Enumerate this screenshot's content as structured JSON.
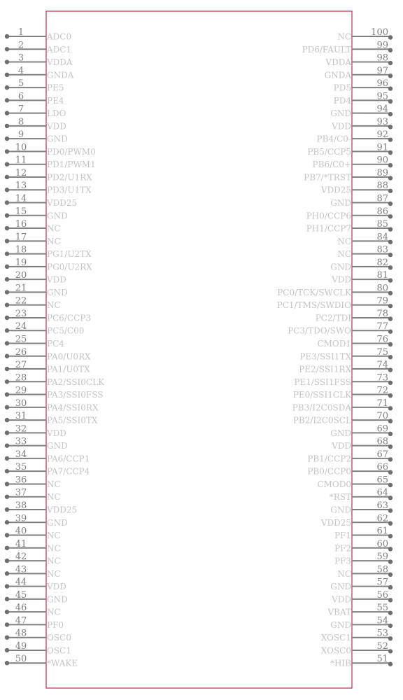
{
  "component": {
    "border_color": "#c8385a",
    "pin_color": "#808080",
    "label_color": "#c4c4c4"
  },
  "left_pins": [
    {
      "num": "1",
      "name": "ADC0"
    },
    {
      "num": "2",
      "name": "ADC1"
    },
    {
      "num": "3",
      "name": "VDDA"
    },
    {
      "num": "4",
      "name": "GNDA"
    },
    {
      "num": "5",
      "name": "PE5"
    },
    {
      "num": "6",
      "name": "PE4"
    },
    {
      "num": "7",
      "name": "LDO"
    },
    {
      "num": "8",
      "name": "VDD"
    },
    {
      "num": "9",
      "name": "GND"
    },
    {
      "num": "10",
      "name": "PD0/PWM0"
    },
    {
      "num": "11",
      "name": "PD1/PWM1"
    },
    {
      "num": "12",
      "name": "PD2/U1RX"
    },
    {
      "num": "13",
      "name": "PD3/U1TX"
    },
    {
      "num": "14",
      "name": "VDD25"
    },
    {
      "num": "15",
      "name": "GND"
    },
    {
      "num": "16",
      "name": "NC"
    },
    {
      "num": "17",
      "name": "NC"
    },
    {
      "num": "18",
      "name": "PG1/U2TX"
    },
    {
      "num": "19",
      "name": "PG0/U2RX"
    },
    {
      "num": "20",
      "name": "VDD"
    },
    {
      "num": "21",
      "name": "GND"
    },
    {
      "num": "22",
      "name": "NC"
    },
    {
      "num": "23",
      "name": "PC6/CCP3"
    },
    {
      "num": "24",
      "name": "PC5/C00"
    },
    {
      "num": "25",
      "name": "PC4"
    },
    {
      "num": "26",
      "name": "PA0/U0RX"
    },
    {
      "num": "27",
      "name": "PA1/U0TX"
    },
    {
      "num": "28",
      "name": "PA2/SSI0CLK"
    },
    {
      "num": "29",
      "name": "PA3/SSI0FSS"
    },
    {
      "num": "30",
      "name": "PA4/SSI0RX"
    },
    {
      "num": "31",
      "name": "PA5/SSI0TX"
    },
    {
      "num": "32",
      "name": "VDD"
    },
    {
      "num": "33",
      "name": "GND"
    },
    {
      "num": "34",
      "name": "PA6/CCP1"
    },
    {
      "num": "35",
      "name": "PA7/CCP4"
    },
    {
      "num": "36",
      "name": "NC"
    },
    {
      "num": "37",
      "name": "NC"
    },
    {
      "num": "38",
      "name": "VDD25"
    },
    {
      "num": "39",
      "name": "GND"
    },
    {
      "num": "40",
      "name": "NC"
    },
    {
      "num": "41",
      "name": "NC"
    },
    {
      "num": "42",
      "name": "NC"
    },
    {
      "num": "43",
      "name": "NC"
    },
    {
      "num": "44",
      "name": "VDD"
    },
    {
      "num": "45",
      "name": "GND"
    },
    {
      "num": "46",
      "name": "NC"
    },
    {
      "num": "47",
      "name": "PF0"
    },
    {
      "num": "48",
      "name": "OSC0"
    },
    {
      "num": "49",
      "name": "OSC1"
    },
    {
      "num": "50",
      "name": "*WAKE"
    }
  ],
  "right_pins": [
    {
      "num": "100",
      "name": "NC"
    },
    {
      "num": "99",
      "name": "PD6/FAULT"
    },
    {
      "num": "98",
      "name": "VDDA"
    },
    {
      "num": "97",
      "name": "GNDA"
    },
    {
      "num": "96",
      "name": "PD5"
    },
    {
      "num": "95",
      "name": "PD4"
    },
    {
      "num": "94",
      "name": "GND"
    },
    {
      "num": "93",
      "name": "VDD"
    },
    {
      "num": "92",
      "name": "PB4/C0-"
    },
    {
      "num": "91",
      "name": "PB5/CCP5"
    },
    {
      "num": "90",
      "name": "PB6/C0+"
    },
    {
      "num": "89",
      "name": "PB7/*TRST"
    },
    {
      "num": "88",
      "name": "VDD25"
    },
    {
      "num": "87",
      "name": "GND"
    },
    {
      "num": "86",
      "name": "PH0/CCP6"
    },
    {
      "num": "85",
      "name": "PH1/CCP7"
    },
    {
      "num": "84",
      "name": "NC"
    },
    {
      "num": "83",
      "name": "NC"
    },
    {
      "num": "82",
      "name": "GND"
    },
    {
      "num": "81",
      "name": "VDD"
    },
    {
      "num": "80",
      "name": "PC0/TCK/SWCLK"
    },
    {
      "num": "79",
      "name": "PC1/TMS/SWDIO"
    },
    {
      "num": "78",
      "name": "PC2/TDI"
    },
    {
      "num": "77",
      "name": "PC3/TDO/SWO"
    },
    {
      "num": "76",
      "name": "CMOD1"
    },
    {
      "num": "75",
      "name": "PE3/SSI1TX"
    },
    {
      "num": "74",
      "name": "PE2/SSI1RX"
    },
    {
      "num": "73",
      "name": "PE1/SSI1FSS"
    },
    {
      "num": "72",
      "name": "PE0/SSI1CLK"
    },
    {
      "num": "71",
      "name": "PB3/I2C0SDA"
    },
    {
      "num": "70",
      "name": "PB2/I2C0SCL"
    },
    {
      "num": "69",
      "name": "GND"
    },
    {
      "num": "68",
      "name": "VDD"
    },
    {
      "num": "67",
      "name": "PB1/CCP2"
    },
    {
      "num": "66",
      "name": "PB0/CCP0"
    },
    {
      "num": "65",
      "name": "CMOD0"
    },
    {
      "num": "64",
      "name": "*RST"
    },
    {
      "num": "63",
      "name": "GND"
    },
    {
      "num": "62",
      "name": "VDD25"
    },
    {
      "num": "61",
      "name": "PF1"
    },
    {
      "num": "60",
      "name": "PF2"
    },
    {
      "num": "59",
      "name": "PF3"
    },
    {
      "num": "58",
      "name": "NC"
    },
    {
      "num": "57",
      "name": "GND"
    },
    {
      "num": "56",
      "name": "VDD"
    },
    {
      "num": "55",
      "name": "VBAT"
    },
    {
      "num": "54",
      "name": "GND"
    },
    {
      "num": "53",
      "name": "XOSC1"
    },
    {
      "num": "52",
      "name": "XOSC0"
    },
    {
      "num": "51",
      "name": "*HIB"
    }
  ]
}
